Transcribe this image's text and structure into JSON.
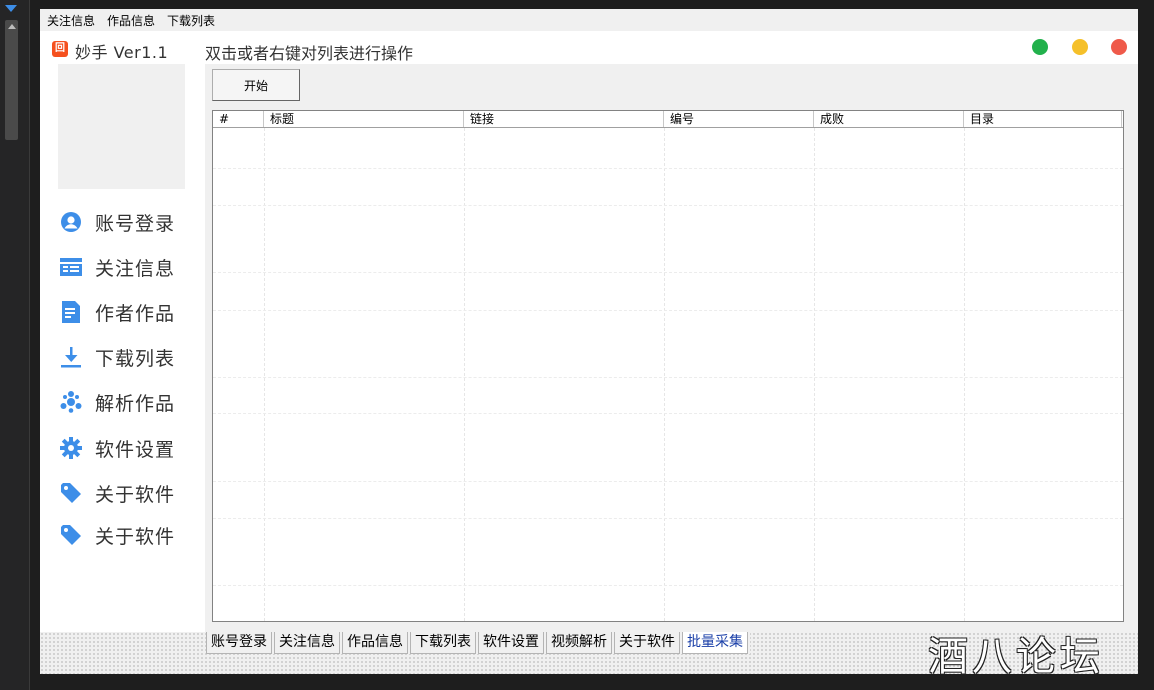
{
  "menubar": {
    "items": [
      "关注信息",
      "作品信息",
      "下载列表"
    ]
  },
  "header": {
    "app_title": "妙手  Ver1.1",
    "hint": "双击或者右键对列表进行操作",
    "window_buttons": {
      "green": "#22b14c",
      "yellow": "#f5c02a",
      "red": "#ef5a4a"
    }
  },
  "sidebar": {
    "items": [
      {
        "label": "账号登录",
        "icon": "user-circle-icon"
      },
      {
        "label": "关注信息",
        "icon": "list-card-icon"
      },
      {
        "label": "作者作品",
        "icon": "document-icon"
      },
      {
        "label": "下载列表",
        "icon": "download-icon"
      },
      {
        "label": "解析作品",
        "icon": "share-nodes-icon"
      },
      {
        "label": "软件设置",
        "icon": "gear-icon"
      },
      {
        "label": "关于软件",
        "icon": "tag-icon"
      },
      {
        "label": "关于软件",
        "icon": "tag-icon"
      }
    ],
    "icon_color": "#3d8ee8"
  },
  "main": {
    "start_button": "开始",
    "table": {
      "columns": [
        "#",
        "标题",
        "链接",
        "编号",
        "成败",
        "目录"
      ],
      "rows": []
    }
  },
  "bottom_tabs": {
    "items": [
      "账号登录",
      "关注信息",
      "作品信息",
      "下载列表",
      "软件设置",
      "视频解析",
      "关于软件",
      "批量采集"
    ],
    "active": "批量采集"
  },
  "watermark": "酒八论坛"
}
